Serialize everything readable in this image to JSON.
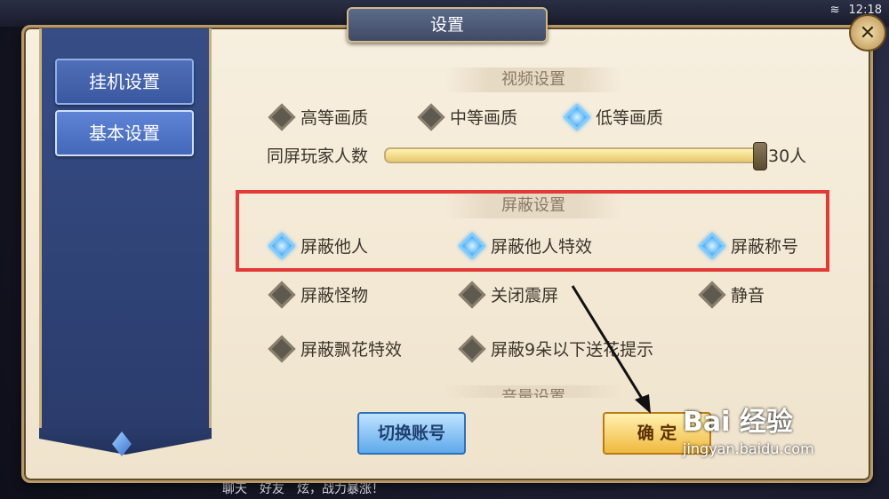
{
  "status_bar": {
    "time": "12:18"
  },
  "dialog": {
    "title": "设置"
  },
  "sidebar": {
    "items": [
      {
        "label": "挂机设置",
        "active": false
      },
      {
        "label": "基本设置",
        "active": true
      }
    ]
  },
  "video_section": {
    "header": "视频设置",
    "quality_options": [
      {
        "label": "高等画质",
        "selected": false
      },
      {
        "label": "中等画质",
        "selected": false
      },
      {
        "label": "低等画质",
        "selected": true
      }
    ],
    "player_count": {
      "label": "同屏玩家人数",
      "value_text": "30人",
      "fill_fraction": 1.0
    }
  },
  "block_section": {
    "header": "屏蔽设置",
    "options": [
      {
        "label": "屏蔽他人",
        "checked": true
      },
      {
        "label": "屏蔽他人特效",
        "checked": true
      },
      {
        "label": "屏蔽称号",
        "checked": true
      },
      {
        "label": "屏蔽怪物",
        "checked": false
      },
      {
        "label": "关闭震屏",
        "checked": false
      },
      {
        "label": "静音",
        "checked": false
      },
      {
        "label": "屏蔽飘花特效",
        "checked": false
      },
      {
        "label": "屏蔽9朵以下送花提示",
        "checked": false
      }
    ]
  },
  "sound_section": {
    "header": "音量设置"
  },
  "buttons": {
    "switch_account": "切换账号",
    "confirm": "确 定"
  },
  "background": {
    "chat_text": "炫，战力暴涨！",
    "chat_tab1": "聊天",
    "chat_tab2": "好友"
  },
  "watermark": {
    "logo": "Bai 经验",
    "url": "jingyan.baidu.com"
  },
  "colors": {
    "highlight": "#e53935",
    "selected_diamond": "#3aa4f2"
  }
}
